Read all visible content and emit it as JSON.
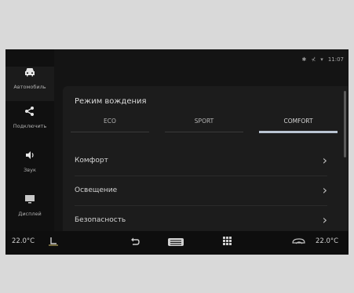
{
  "status": {
    "bluetooth_icon": "bluetooth-icon",
    "signal_icon": "signal-icon",
    "wifi_icon": "wifi-icon",
    "time": "11:07"
  },
  "sidebar": {
    "items": [
      {
        "label": "Автомобиль",
        "icon": "car-icon",
        "glyph": "⛟"
      },
      {
        "label": "Подключить",
        "icon": "share-icon",
        "glyph": "⋖"
      },
      {
        "label": "Звук",
        "icon": "speaker-icon",
        "glyph": "◀"
      },
      {
        "label": "Дисплей",
        "icon": "display-icon",
        "glyph": "▭"
      }
    ]
  },
  "panel": {
    "title": "Режим вождения",
    "tabs": [
      {
        "label": "ECO"
      },
      {
        "label": "SPORT"
      },
      {
        "label": "COMFORT"
      }
    ],
    "active_tab": "COMFORT",
    "rows": [
      {
        "label": "Комфорт"
      },
      {
        "label": "Освещение"
      },
      {
        "label": "Безопасность"
      }
    ]
  },
  "bottombar": {
    "left_temp": "22.0°C",
    "right_temp": "22.0°C",
    "seat_icon": "seat-heat-icon",
    "back_icon": "back-icon",
    "defrost_icon": "defrost-icon",
    "apps_icon": "apps-icon",
    "recirc_icon": "recirculation-icon"
  }
}
